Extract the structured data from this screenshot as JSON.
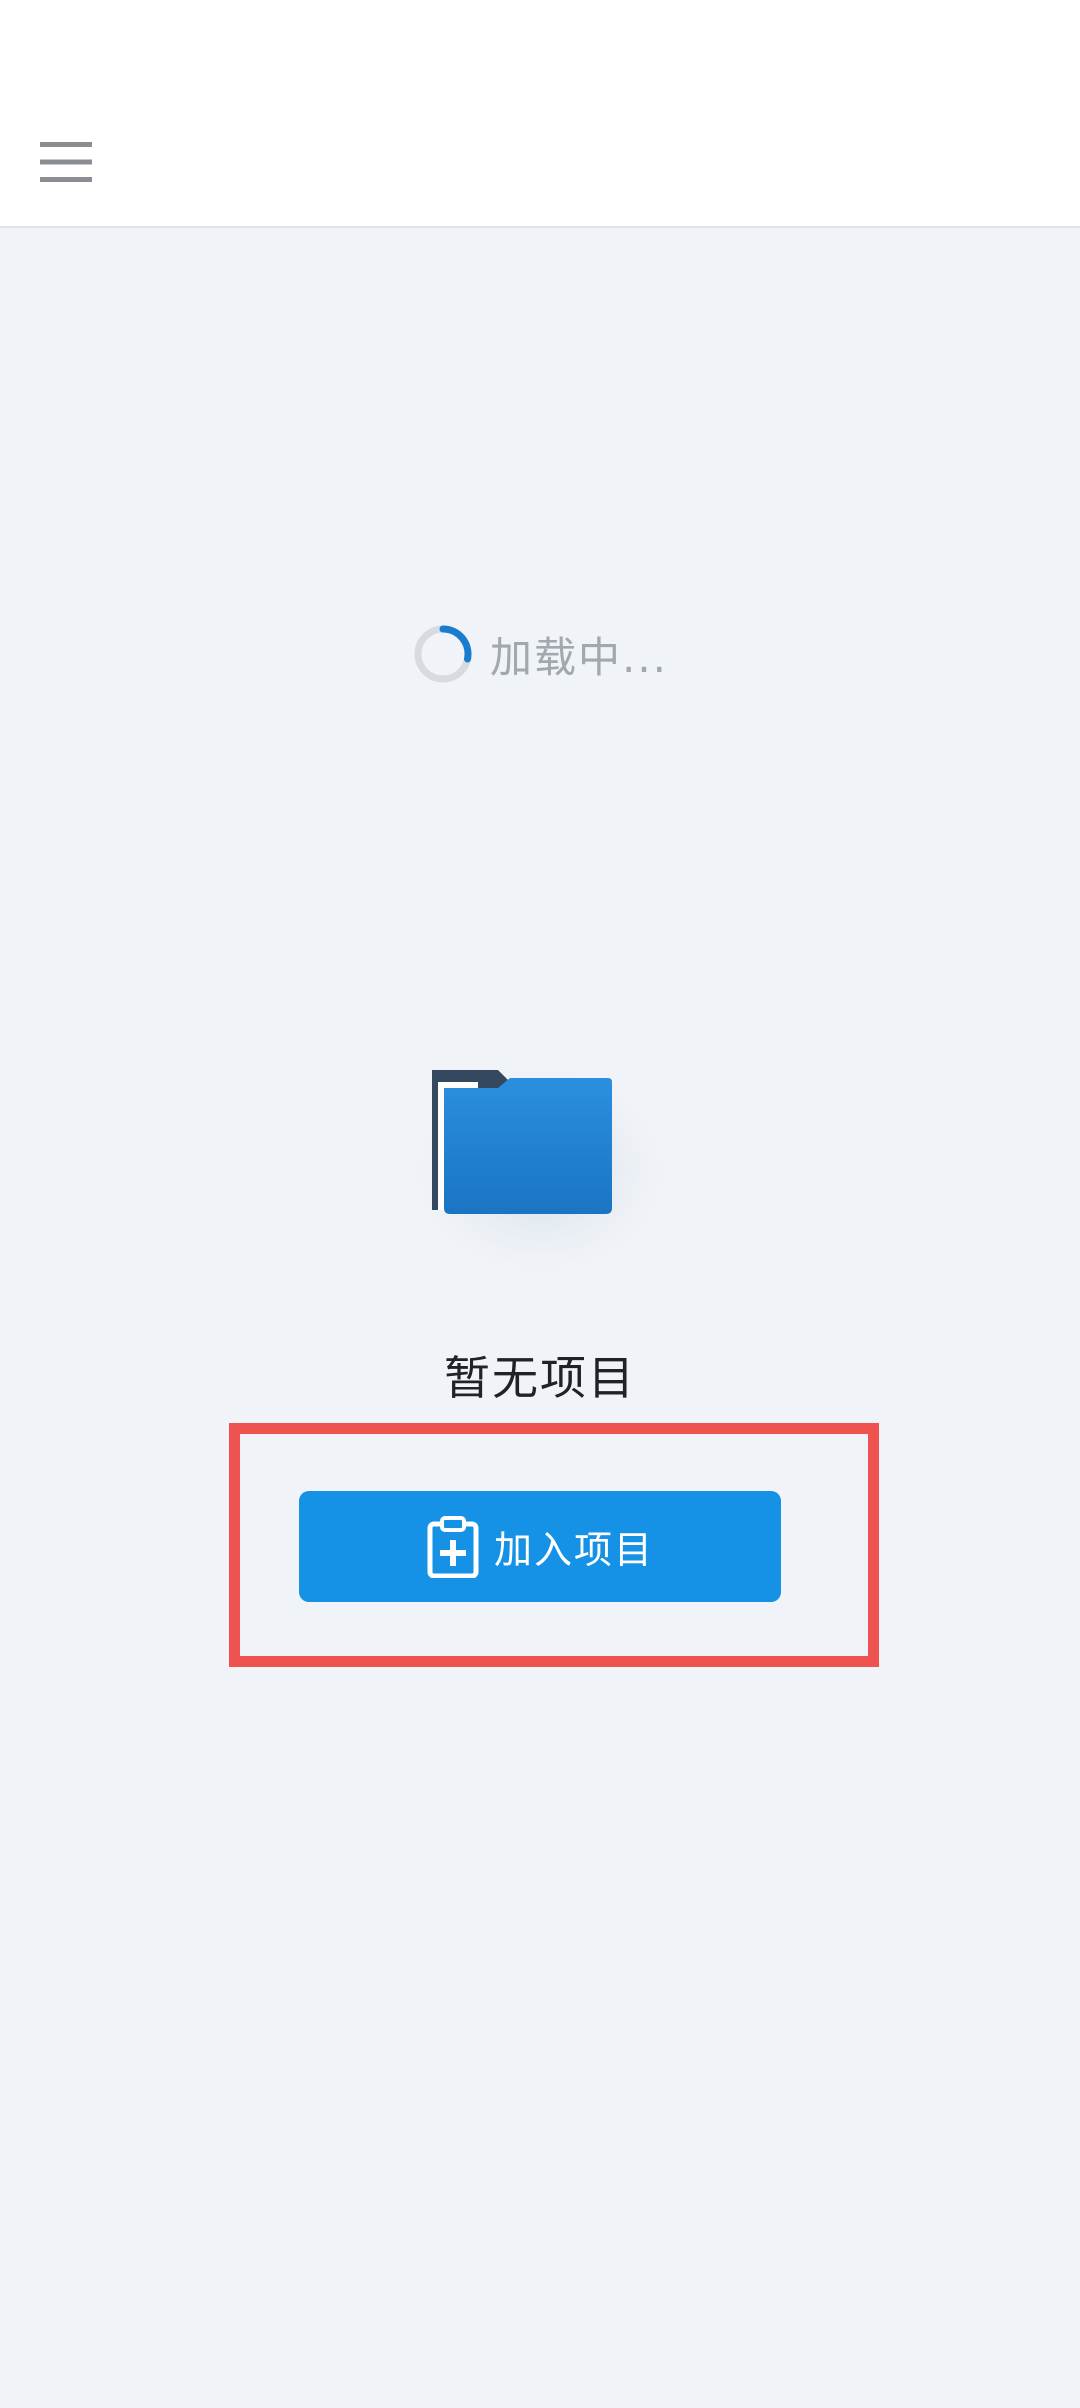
{
  "header": {
    "menu_icon": "hamburger-menu-icon"
  },
  "loading": {
    "icon": "spinner-icon",
    "text": "加载中..."
  },
  "empty_state": {
    "icon": "folder-icon",
    "text": "暂无项目",
    "button": {
      "icon": "clipboard-plus-icon",
      "label": "加入项目"
    },
    "highlight_color": "#ef5350"
  },
  "colors": {
    "accent": "#1592e6",
    "background": "#f0f3f7"
  }
}
